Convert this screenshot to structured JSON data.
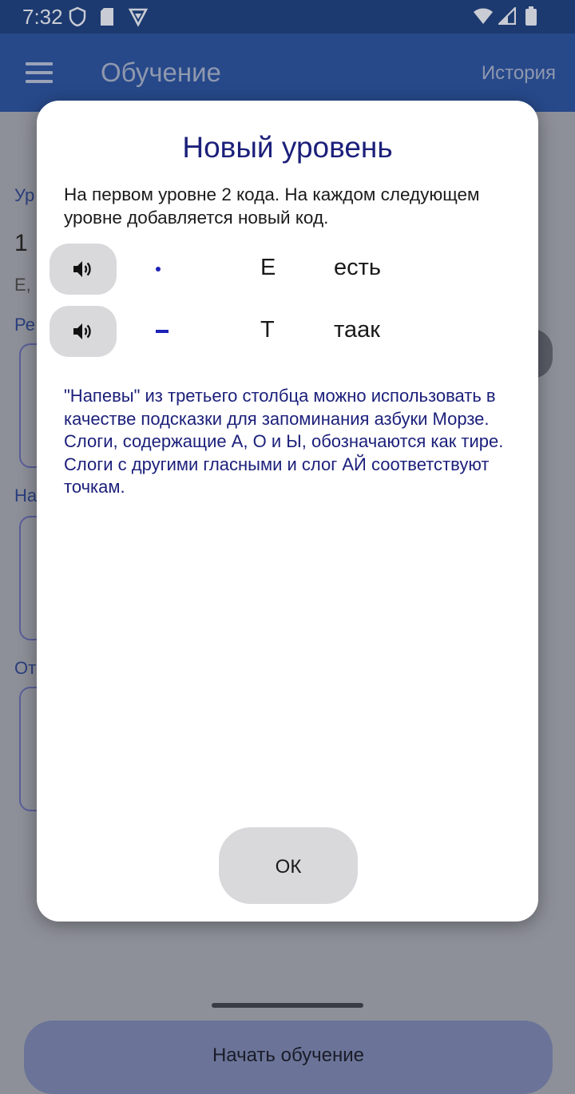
{
  "status_bar": {
    "time": "7:32",
    "left_icons": [
      "shield-icon",
      "sd-card-icon",
      "vpn-icon"
    ],
    "right_icons": [
      "wifi-icon",
      "signal-icon",
      "battery-icon"
    ]
  },
  "app_bar": {
    "title": "Обучение",
    "history_label": "История",
    "menu_icon": "menu-icon"
  },
  "background": {
    "start_button_label": "Начать обучение"
  },
  "dialog": {
    "title": "Новый уровень",
    "intro": "На первом уровне 2 кода. На каждом следующем уровне добавляется новый код.",
    "rows": [
      {
        "morse": "dot",
        "letter": "Е",
        "mnemonic": "есть"
      },
      {
        "morse": "dash",
        "letter": "Т",
        "mnemonic": "таак"
      }
    ],
    "note": "\"Напевы\" из третьего столбца можно использовать в качестве подсказки для запоминания азбуки Морзе. Слоги, содержащие А, О и Ы, обозначаются как тире. Слоги с другими гласными и слог АЙ соответствуют точкам.",
    "ok_label": "ОК"
  },
  "colors": {
    "app_bar": "#27498a",
    "status_bar": "#1c3a70",
    "dialog_title": "#1b1f7a",
    "morse_symbol": "#1d22b8",
    "button_bg": "#d9d9dc"
  }
}
